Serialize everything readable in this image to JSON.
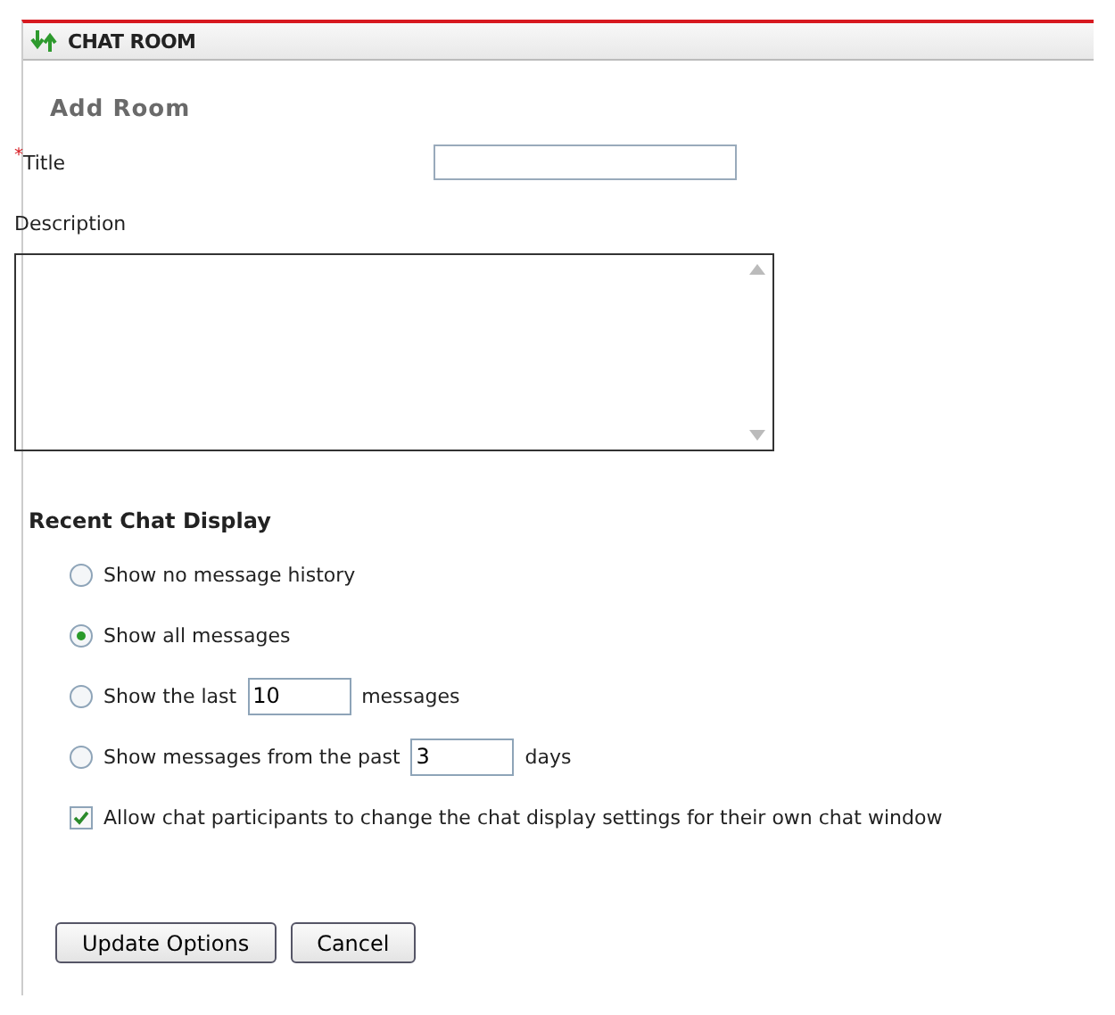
{
  "panel": {
    "title": "CHAT ROOM"
  },
  "heading": "Add Room",
  "title_field": {
    "required_mark": "*",
    "label": "Title"
  },
  "description_field": {
    "label": "Description"
  },
  "recent": {
    "heading": "Recent Chat Display",
    "options": [
      {
        "kind": "plain",
        "label": "Show no message history",
        "selected": false
      },
      {
        "kind": "plain",
        "label": "Show all messages",
        "selected": true
      },
      {
        "kind": "field",
        "label": "Show the last",
        "value": "10",
        "suffix": "messages",
        "selected": false
      },
      {
        "kind": "field",
        "label": "Show messages from the past",
        "value": "3",
        "suffix": "days",
        "selected": false
      }
    ],
    "allow": {
      "label": "Allow chat participants to change the chat display settings for their own chat window",
      "checked": true
    }
  },
  "buttons": [
    "Update Options",
    "Cancel"
  ]
}
